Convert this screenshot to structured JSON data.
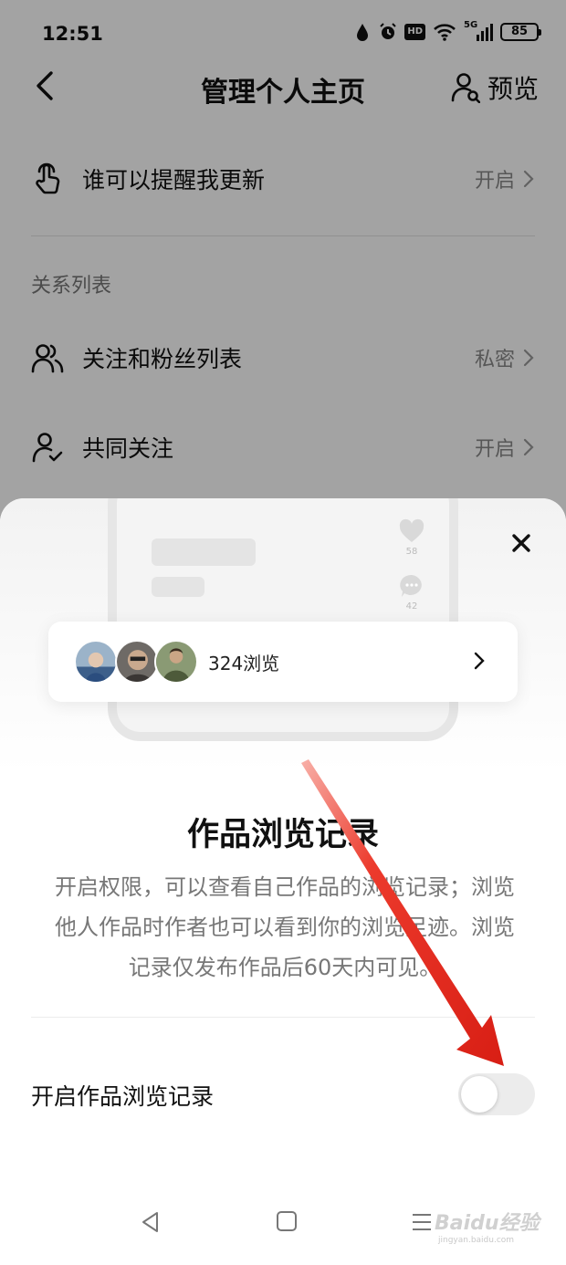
{
  "status_bar": {
    "time": "12:51",
    "network": "5G",
    "battery": "85",
    "hd": "HD"
  },
  "top_bar": {
    "title": "管理个人主页",
    "preview_label": "预览"
  },
  "settings": {
    "remind_row": {
      "label": "谁可以提醒我更新",
      "value": "开启"
    },
    "section_title": "关系列表",
    "follow_row": {
      "label": "关注和粉丝列表",
      "value": "私密"
    },
    "common_row": {
      "label": "共同关注",
      "value": "开启"
    }
  },
  "sheet": {
    "mock": {
      "likes": "58",
      "comments": "42"
    },
    "views_card": {
      "text": "324浏览"
    },
    "title": "作品浏览记录",
    "description": "开启权限，可以查看自己作品的浏览记录；浏览他人作品时作者也可以看到你的浏览足迹。浏览记录仅发布作品后60天内可见。",
    "toggle_label": "开启作品浏览记录",
    "toggle_on": false
  },
  "watermark": {
    "main": "Baidu经验",
    "sub": "jingyan.baidu.com"
  },
  "colors": {
    "arrow": "#e8231a",
    "dim": "rgba(0,0,0,0.36)",
    "toggle_off": "#ececec"
  },
  "icons": {
    "back": "chevron-left-icon",
    "preview": "user-preview-icon",
    "remind": "hand-pointer-icon",
    "follow": "users-icon",
    "common": "user-check-icon",
    "close": "close-icon"
  }
}
